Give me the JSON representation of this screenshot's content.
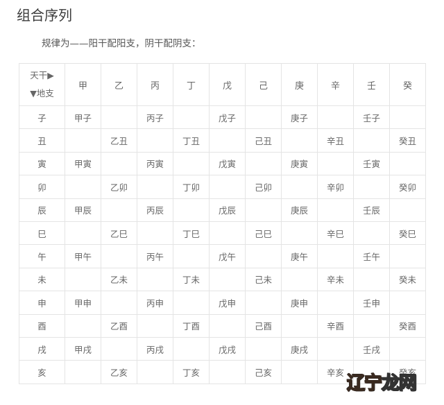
{
  "heading": "组合序列",
  "rule_text": "规律为——阳干配阳支，阴干配阴支：",
  "table": {
    "corner": {
      "top": "天干▶",
      "bottom": "▼地支"
    },
    "stems": [
      "甲",
      "乙",
      "丙",
      "丁",
      "戊",
      "己",
      "庚",
      "辛",
      "壬",
      "癸"
    ],
    "rows": [
      {
        "branch": "子",
        "cells": [
          "甲子",
          "",
          "丙子",
          "",
          "戊子",
          "",
          "庚子",
          "",
          "壬子",
          ""
        ]
      },
      {
        "branch": "丑",
        "cells": [
          "",
          "乙丑",
          "",
          "丁丑",
          "",
          "己丑",
          "",
          "辛丑",
          "",
          "癸丑"
        ]
      },
      {
        "branch": "寅",
        "cells": [
          "甲寅",
          "",
          "丙寅",
          "",
          "戊寅",
          "",
          "庚寅",
          "",
          "壬寅",
          ""
        ]
      },
      {
        "branch": "卯",
        "cells": [
          "",
          "乙卯",
          "",
          "丁卯",
          "",
          "己卯",
          "",
          "辛卯",
          "",
          "癸卯"
        ]
      },
      {
        "branch": "辰",
        "cells": [
          "甲辰",
          "",
          "丙辰",
          "",
          "戊辰",
          "",
          "庚辰",
          "",
          "壬辰",
          ""
        ]
      },
      {
        "branch": "巳",
        "cells": [
          "",
          "乙巳",
          "",
          "丁巳",
          "",
          "己巳",
          "",
          "辛巳",
          "",
          "癸巳"
        ]
      },
      {
        "branch": "午",
        "cells": [
          "甲午",
          "",
          "丙午",
          "",
          "戊午",
          "",
          "庚午",
          "",
          "壬午",
          ""
        ]
      },
      {
        "branch": "未",
        "cells": [
          "",
          "乙未",
          "",
          "丁未",
          "",
          "己未",
          "",
          "辛未",
          "",
          "癸未"
        ]
      },
      {
        "branch": "申",
        "cells": [
          "甲申",
          "",
          "丙申",
          "",
          "戊申",
          "",
          "庚申",
          "",
          "壬申",
          ""
        ]
      },
      {
        "branch": "酉",
        "cells": [
          "",
          "乙酉",
          "",
          "丁酉",
          "",
          "己酉",
          "",
          "辛酉",
          "",
          "癸酉"
        ]
      },
      {
        "branch": "戌",
        "cells": [
          "甲戌",
          "",
          "丙戌",
          "",
          "戊戌",
          "",
          "庚戌",
          "",
          "壬戌",
          ""
        ]
      },
      {
        "branch": "亥",
        "cells": [
          "",
          "乙亥",
          "",
          "丁亥",
          "",
          "己亥",
          "",
          "辛亥",
          "",
          "癸亥"
        ]
      }
    ]
  },
  "watermark": {
    "part1": "辽宁",
    "part2": "龙网",
    "accent_color": "#e5531f"
  }
}
